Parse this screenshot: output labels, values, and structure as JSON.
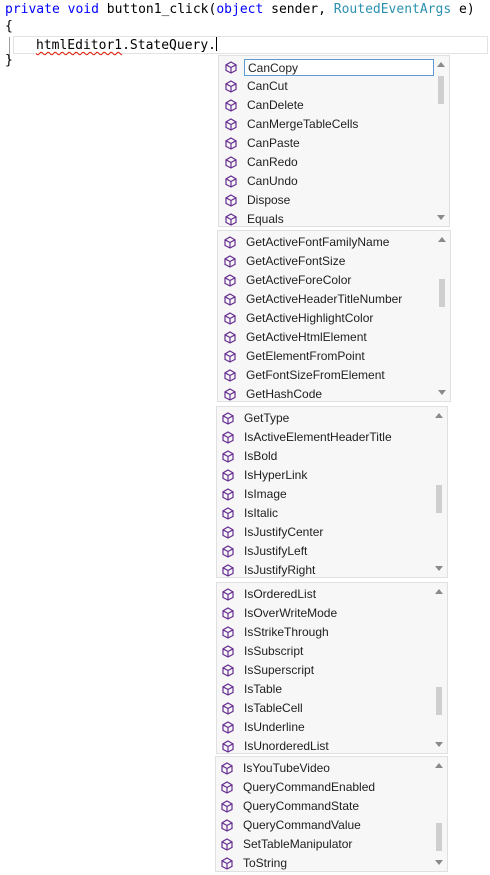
{
  "code": {
    "line1": {
      "kw1": "private",
      "kw2": "void",
      "name": "button1_click(",
      "kw3": "object",
      "p1": " sender, ",
      "type": "RoutedEventArgs",
      "p2": " e)"
    },
    "line2": "{",
    "line3": {
      "expr": "htmlEditor1",
      "rest": ".StateQuery."
    },
    "line4": "}"
  },
  "icon": "method-cube-icon",
  "colors": {
    "keyword": "#0000ff",
    "type": "#2b91af",
    "icon": "#652d90",
    "selection_border": "#5b9bd5"
  },
  "lists": [
    {
      "items": [
        "CanCopy",
        "CanCut",
        "CanDelete",
        "CanMergeTableCells",
        "CanPaste",
        "CanRedo",
        "CanUndo",
        "Dispose",
        "Equals"
      ],
      "selected": 0
    },
    {
      "items": [
        "GetActiveFontFamilyName",
        "GetActiveFontSize",
        "GetActiveForeColor",
        "GetActiveHeaderTitleNumber",
        "GetActiveHighlightColor",
        "GetActiveHtmlElement",
        "GetElementFromPoint",
        "GetFontSizeFromElement",
        "GetHashCode"
      ],
      "selected": -1
    },
    {
      "items": [
        "GetType",
        "IsActiveElementHeaderTitle",
        "IsBold",
        "IsHyperLink",
        "IsImage",
        "IsItalic",
        "IsJustifyCenter",
        "IsJustifyLeft",
        "IsJustifyRight"
      ],
      "selected": -1
    },
    {
      "items": [
        "IsOrderedList",
        "IsOverWriteMode",
        "IsStrikeThrough",
        "IsSubscript",
        "IsSuperscript",
        "IsTable",
        "IsTableCell",
        "IsUnderline",
        "IsUnorderedList"
      ],
      "selected": -1
    },
    {
      "items": [
        "IsYouTubeVideo",
        "QueryCommandEnabled",
        "QueryCommandState",
        "QueryCommandValue",
        "SetTableManipulator",
        "ToString"
      ],
      "selected": -1
    }
  ]
}
